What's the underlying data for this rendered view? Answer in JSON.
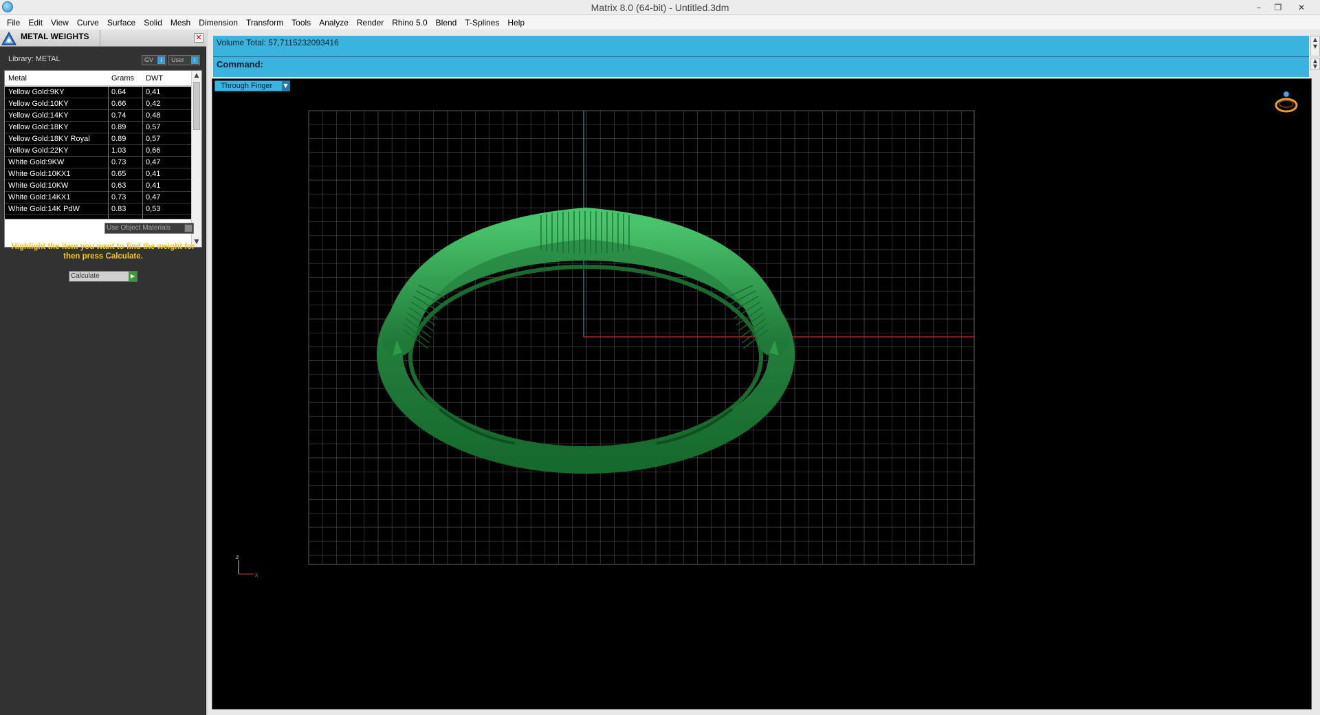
{
  "window": {
    "title": "Matrix 8.0 (64-bit) - Untitled.3dm",
    "minimize_glyph": "–",
    "restore_glyph": "❐",
    "close_glyph": "✕"
  },
  "menu": [
    "File",
    "Edit",
    "View",
    "Curve",
    "Surface",
    "Solid",
    "Mesh",
    "Dimension",
    "Transform",
    "Tools",
    "Analyze",
    "Render",
    "Rhino 5.0",
    "Blend",
    "T-Splines",
    "Help"
  ],
  "panel": {
    "title": "METAL WEIGHTS",
    "close_glyph": "✕",
    "library_label": "Library: METAL",
    "gv_label": "GV",
    "user_label": "User",
    "table": {
      "headers": [
        "Metal",
        "Grams",
        "DWT"
      ],
      "rows": [
        [
          "Yellow Gold:9KY",
          "0.64",
          "0,41"
        ],
        [
          "Yellow Gold:10KY",
          "0.66",
          "0,42"
        ],
        [
          "Yellow Gold:14KY",
          "0.74",
          "0,48"
        ],
        [
          "Yellow Gold:18KY",
          "0.89",
          "0,57"
        ],
        [
          "Yellow Gold:18KY Royal",
          "0.89",
          "0,57"
        ],
        [
          "Yellow Gold:22KY",
          "1.03",
          "0,66"
        ],
        [
          "White Gold:9KW",
          "0.73",
          "0,47"
        ],
        [
          "White Gold:10KX1",
          "0.65",
          "0,41"
        ],
        [
          "White Gold:10KW",
          "0.63",
          "0,41"
        ],
        [
          "White Gold:14KX1",
          "0.73",
          "0,47"
        ],
        [
          "White Gold:14K PdW",
          "0.83",
          "0,53"
        ]
      ]
    },
    "use_materials_label": "Use Object Materials",
    "hint": "Highlight the item you want to find the weight for then press Calculate.",
    "calculate_label": "Calculate"
  },
  "command": {
    "output": "Volume Total: 57,7115232093416",
    "prompt": "Command:"
  },
  "viewport": {
    "view_name": "Through Finger",
    "axis_y_label": "z",
    "axis_x_label": "x",
    "ring_color": "#2e9a4a",
    "grid_color": "#444444",
    "x_axis_color": "#b02020",
    "y_axis_color": "#4a8a9a"
  }
}
